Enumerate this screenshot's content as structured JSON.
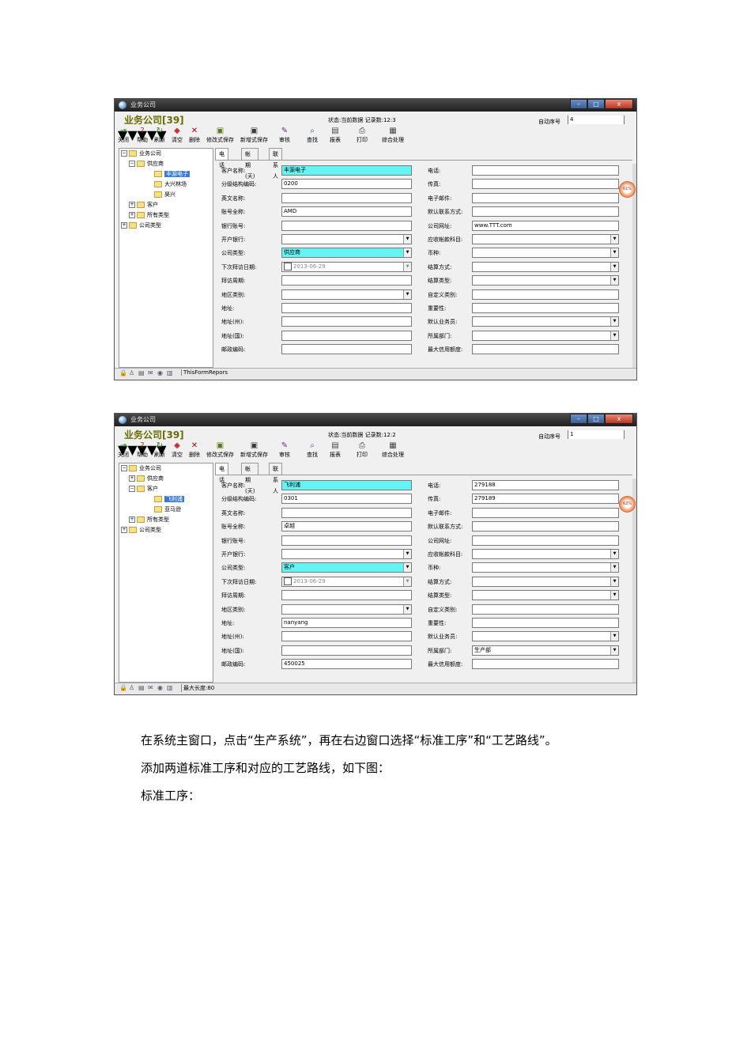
{
  "window_title": "业务公司",
  "app_title": "业务公司[39]",
  "seq_label": "自动序号",
  "toolbar": [
    "关闭",
    "帮助",
    "刷新",
    "清空",
    "删除",
    "修改式保存",
    "新增式保存",
    "审核",
    "查找",
    "报表",
    "打印",
    "综合处理"
  ],
  "tabs": [
    "电话",
    "帐期(天)",
    "联系人"
  ],
  "left_labels": [
    "客户名称:",
    "分级结构编码:",
    "英文名称:",
    "账号全称:",
    "银行账号:",
    "开户银行:",
    "公司类型:",
    "下次拜访日期:",
    "拜访周期:",
    "地区类别:",
    "地址:",
    "地址(州):",
    "地址(国):",
    "邮政编码:"
  ],
  "right_labels": [
    "电话:",
    "传真:",
    "电子邮件:",
    "默认联系方式:",
    "公司网址:",
    "应收帐款科目:",
    "币种:",
    "结算方式:",
    "结算类型:",
    "自定义类别:",
    "重要性:",
    "默认业务员:",
    "所属部门:",
    "最大信用额度:"
  ],
  "screen1": {
    "status": "状态:当前数据 记录数:12:3",
    "seq_value": "4",
    "tree": [
      "业务公司",
      "供应商",
      "丰源电子",
      "大兴林场",
      "昊兴",
      "客户",
      "所有类型",
      "公司类型"
    ],
    "left_values": [
      "丰源电子",
      "0200",
      "",
      "AMD",
      "",
      "",
      "供应商",
      "2013-06-29",
      "",
      "",
      "",
      "",
      "",
      ""
    ],
    "right_values": [
      "",
      "",
      "",
      "",
      "www.TTT.com",
      "",
      "",
      "",
      "",
      "",
      "",
      "",
      "",
      ""
    ],
    "badge": "61%",
    "status_text": "ThisFormRepors"
  },
  "screen2": {
    "status": "状态:当前数据 记录数:12:2",
    "seq_value": "1",
    "tree": [
      "业务公司",
      "供应商",
      "客户",
      "飞利浦",
      "亚马逊",
      "所有类型",
      "公司类型"
    ],
    "left_values": [
      "飞利浦",
      "0301",
      "",
      "卓越",
      "",
      "",
      "客户",
      "2013-06-29",
      "",
      "",
      "nanyang",
      "",
      "",
      "450025"
    ],
    "right_values": [
      "279188",
      "279189",
      "",
      "",
      "",
      "",
      "",
      "",
      "",
      "",
      "",
      "",
      "生产部",
      ""
    ],
    "badge": "62%",
    "status_text": "最大长度:80"
  },
  "paragraphs": [
    "在系统主窗口，点击“生产系统”，再在右边窗口选择“标准工序”和“工艺路线”。",
    "添加两道标准工序和对应的工艺路线，如下图：",
    "标准工序："
  ]
}
